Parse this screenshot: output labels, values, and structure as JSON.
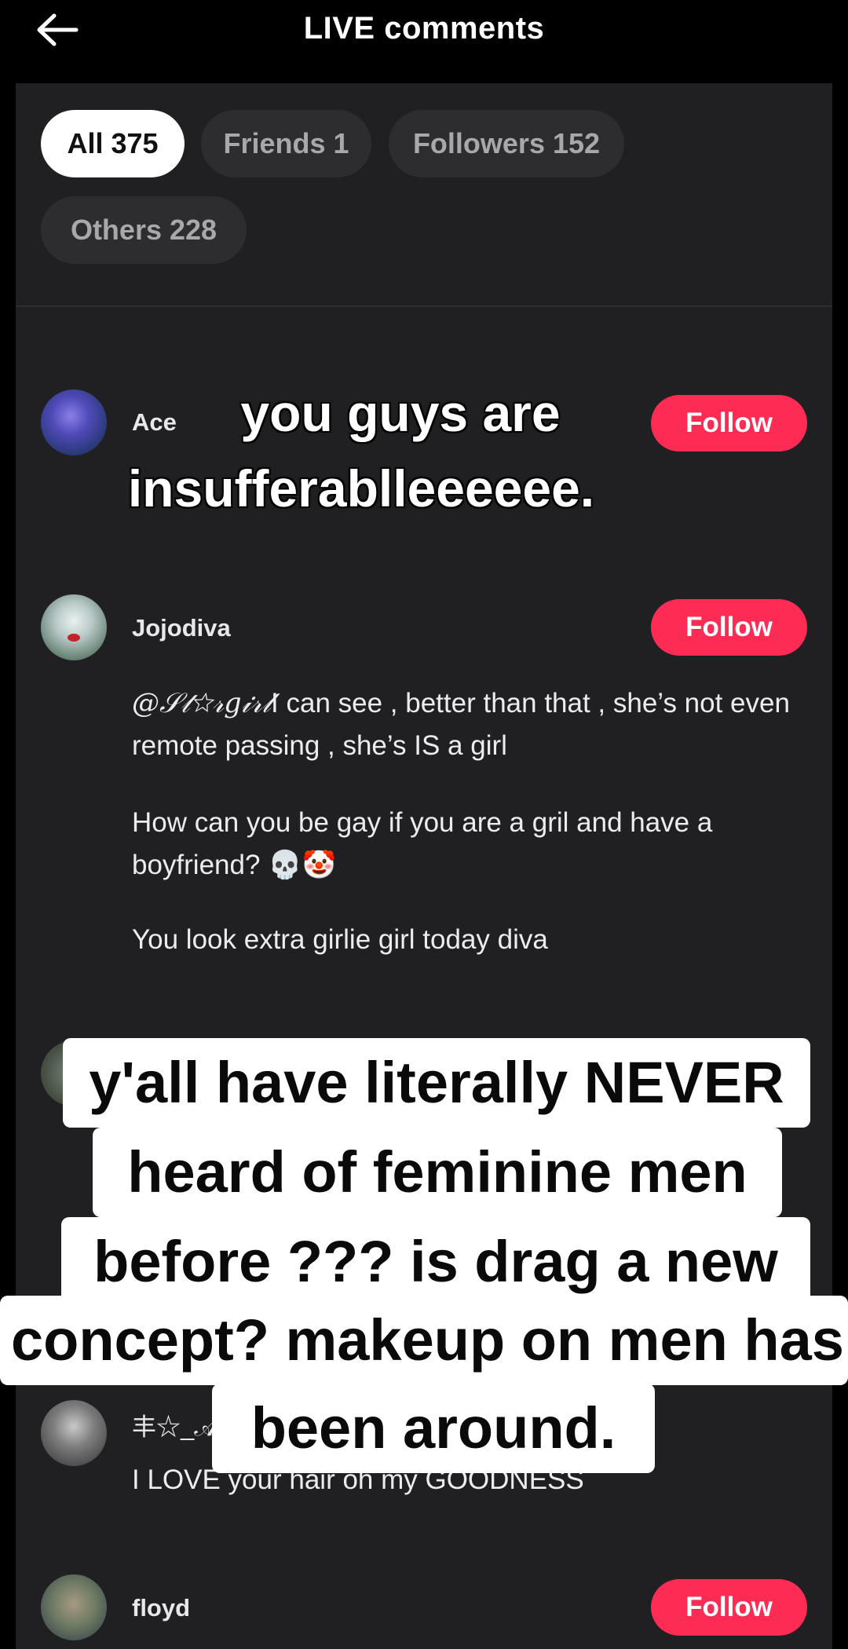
{
  "header": {
    "title": "LIVE comments",
    "back_icon": "arrow-left-icon"
  },
  "filters": [
    {
      "label": "All 375",
      "active": true
    },
    {
      "label": "Friends 1",
      "active": false
    },
    {
      "label": "Followers 152",
      "active": false
    },
    {
      "label": "Others 228",
      "active": false
    }
  ],
  "comments": [
    {
      "username": "Ace",
      "follow_label": "Follow"
    },
    {
      "username": "Jojodiva",
      "follow_label": "Follow",
      "mention": "@𝒮𝓉☆𝓇𝑔𝒾𝓇𝓁",
      "lines": [
        "I can see , better than that , she’s not even remote passing , she’s IS a girl",
        "How can you be gay if you are a gril and have a boyfriend? 💀🤡",
        "You look extra girlie girl today diva"
      ]
    },
    {
      "username": "丰☆_𝒜",
      "text": "I LOVE your hair oh my GOODNESS"
    },
    {
      "username": "floyd",
      "follow_label": "Follow"
    }
  ],
  "overlays": {
    "top_caption": [
      "you guys are",
      "insufferablleeeeee."
    ],
    "bottom_caption": [
      "y'all have literally NEVER",
      "heard of feminine men",
      "before ??? is drag a new",
      "concept? makeup on men has",
      "been around."
    ]
  },
  "colors": {
    "background": "#000000",
    "panel": "#202022",
    "chip": "#2d2d30",
    "follow": "#fe2c55"
  }
}
